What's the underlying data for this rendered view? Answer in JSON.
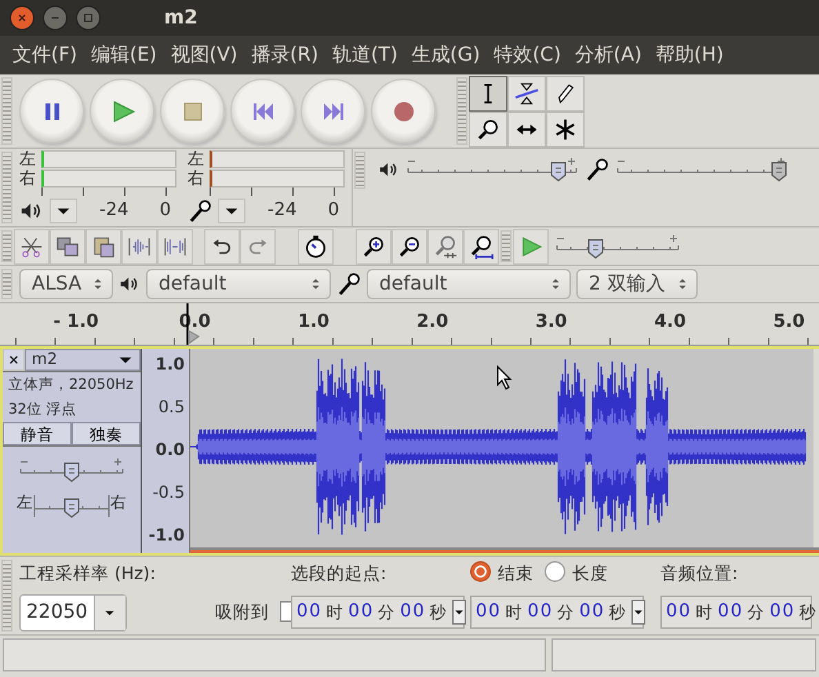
{
  "window": {
    "title": "m2"
  },
  "menu": [
    "文件(F)",
    "编辑(E)",
    "视图(V)",
    "播录(R)",
    "轨道(T)",
    "生成(G)",
    "特效(C)",
    "分析(A)",
    "帮助(H)"
  ],
  "tools": [
    {
      "selected": true
    },
    {
      "selected": false
    },
    {
      "selected": false
    },
    {
      "selected": false
    },
    {
      "selected": false
    },
    {
      "selected": false
    }
  ],
  "meters": [
    {
      "channels": [
        "左",
        "右"
      ],
      "scale": [
        "-24",
        "0"
      ]
    },
    {
      "channels": [
        "左",
        "右"
      ],
      "scale": [
        "-24",
        "0"
      ]
    }
  ],
  "mixer": {
    "playback": {
      "level": 0.93
    },
    "recording": {
      "level": 1.0
    }
  },
  "speed": {
    "level": 0.3
  },
  "devices": {
    "host": "ALSA",
    "output": "default",
    "input": "default",
    "channels": "2 双输入"
  },
  "ruler": [
    "- 1.0",
    "0.0",
    "1.0",
    "2.0",
    "3.0",
    "4.0",
    "5.0"
  ],
  "track": {
    "name": "m2",
    "info": [
      "立体声，22050Hz",
      "32位 浮点"
    ],
    "buttons": [
      {
        "label": "静音",
        "on": false
      },
      {
        "label": "独奏",
        "on": false
      }
    ],
    "gain": {
      "level": 0.5
    },
    "pan": {
      "left": "左",
      "right": "右",
      "level": 0.5
    },
    "scale": [
      "1.0",
      "0.5",
      "0.0",
      "-0.5",
      "-1.0"
    ]
  },
  "selection_bar": {
    "rate_label": "工程采样率 (Hz):",
    "rate": "22050",
    "snap_label": "吸附到",
    "snap": false,
    "start_label": "选段的起点:",
    "radios": [
      {
        "label": "结束",
        "selected": true
      },
      {
        "label": "长度",
        "selected": false
      }
    ],
    "position_label": "音频位置:",
    "times": [
      [
        {
          "digits": "00",
          "unit": "时"
        },
        {
          "digits": "00",
          "unit": "分"
        },
        {
          "digits": "00",
          "unit": "秒"
        }
      ],
      [
        {
          "digits": "00",
          "unit": "时"
        },
        {
          "digits": "00",
          "unit": "分"
        },
        {
          "digits": "00",
          "unit": "秒"
        }
      ],
      [
        {
          "digits": "00",
          "unit": "时"
        },
        {
          "digits": "00",
          "unit": "分"
        },
        {
          "digits": "00",
          "unit": "秒"
        }
      ]
    ]
  }
}
